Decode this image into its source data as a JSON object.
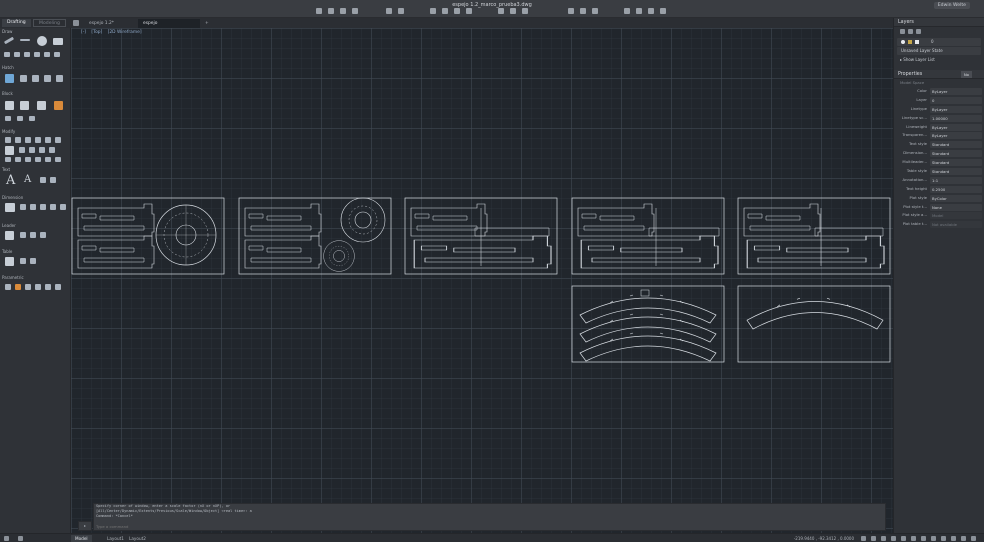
{
  "app": {
    "title": "espejo 1.2_marco_prueba3.dwg",
    "user": "Edwin Welte"
  },
  "workspaces": [
    "Drafting",
    "Modeling"
  ],
  "file_tabs": [
    "espejo 1.2*",
    "espejo 1.2_marco_prueba3*"
  ],
  "palette_sections": [
    "Draw",
    "Hatch",
    "Block",
    "Modify",
    "Text",
    "Dimension",
    "Leader",
    "Table",
    "Parametric"
  ],
  "canvas": {
    "view_controls": [
      "[-]",
      "[Top]",
      "[2D Wireframe]"
    ]
  },
  "command_line": {
    "history": [
      "Specify corner of window, enter a scale factor (nX or nXP), or",
      "[All/Center/Dynamic/Extents/Previous/Scale/Window/Object] <real time>: a",
      "Command: *Cancel*"
    ],
    "placeholder": "Type a command"
  },
  "layers": {
    "header": "Layers",
    "current_layer": "0",
    "state_dropdown": "Unsaved Layer State",
    "show_list": "Show Layer List"
  },
  "properties": {
    "header": "Properties",
    "selection": "No",
    "model_space": "Model Space",
    "rows": [
      {
        "label": "Color",
        "value": "ByLayer"
      },
      {
        "label": "Layer",
        "value": "0"
      },
      {
        "label": "Linetype",
        "value": "ByLayer"
      },
      {
        "label": "Linetype sc...",
        "value": "1.00000"
      },
      {
        "label": "Lineweight",
        "value": "ByLayer"
      },
      {
        "label": "Transparen...",
        "value": "ByLayer"
      },
      {
        "label": "Text style",
        "value": "Standard"
      },
      {
        "label": "Dimension...",
        "value": "Standard"
      },
      {
        "label": "Multileader...",
        "value": "Standard"
      },
      {
        "label": "Table style",
        "value": "Standard"
      },
      {
        "label": "Annotation...",
        "value": "1:1"
      },
      {
        "label": "Text height",
        "value": "0.2500"
      },
      {
        "label": "Plot style",
        "value": "ByColor"
      },
      {
        "label": "Plot style t...",
        "value": "None"
      },
      {
        "label": "Plot style a...",
        "value": "Model"
      },
      {
        "label": "Plot table t...",
        "value": "Not available"
      }
    ]
  },
  "status_bar": {
    "layout_tabs": [
      "Model",
      "Layout1",
      "Layout2"
    ],
    "coordinates": "-219.9440 , -92.3412 , 0.0000"
  }
}
